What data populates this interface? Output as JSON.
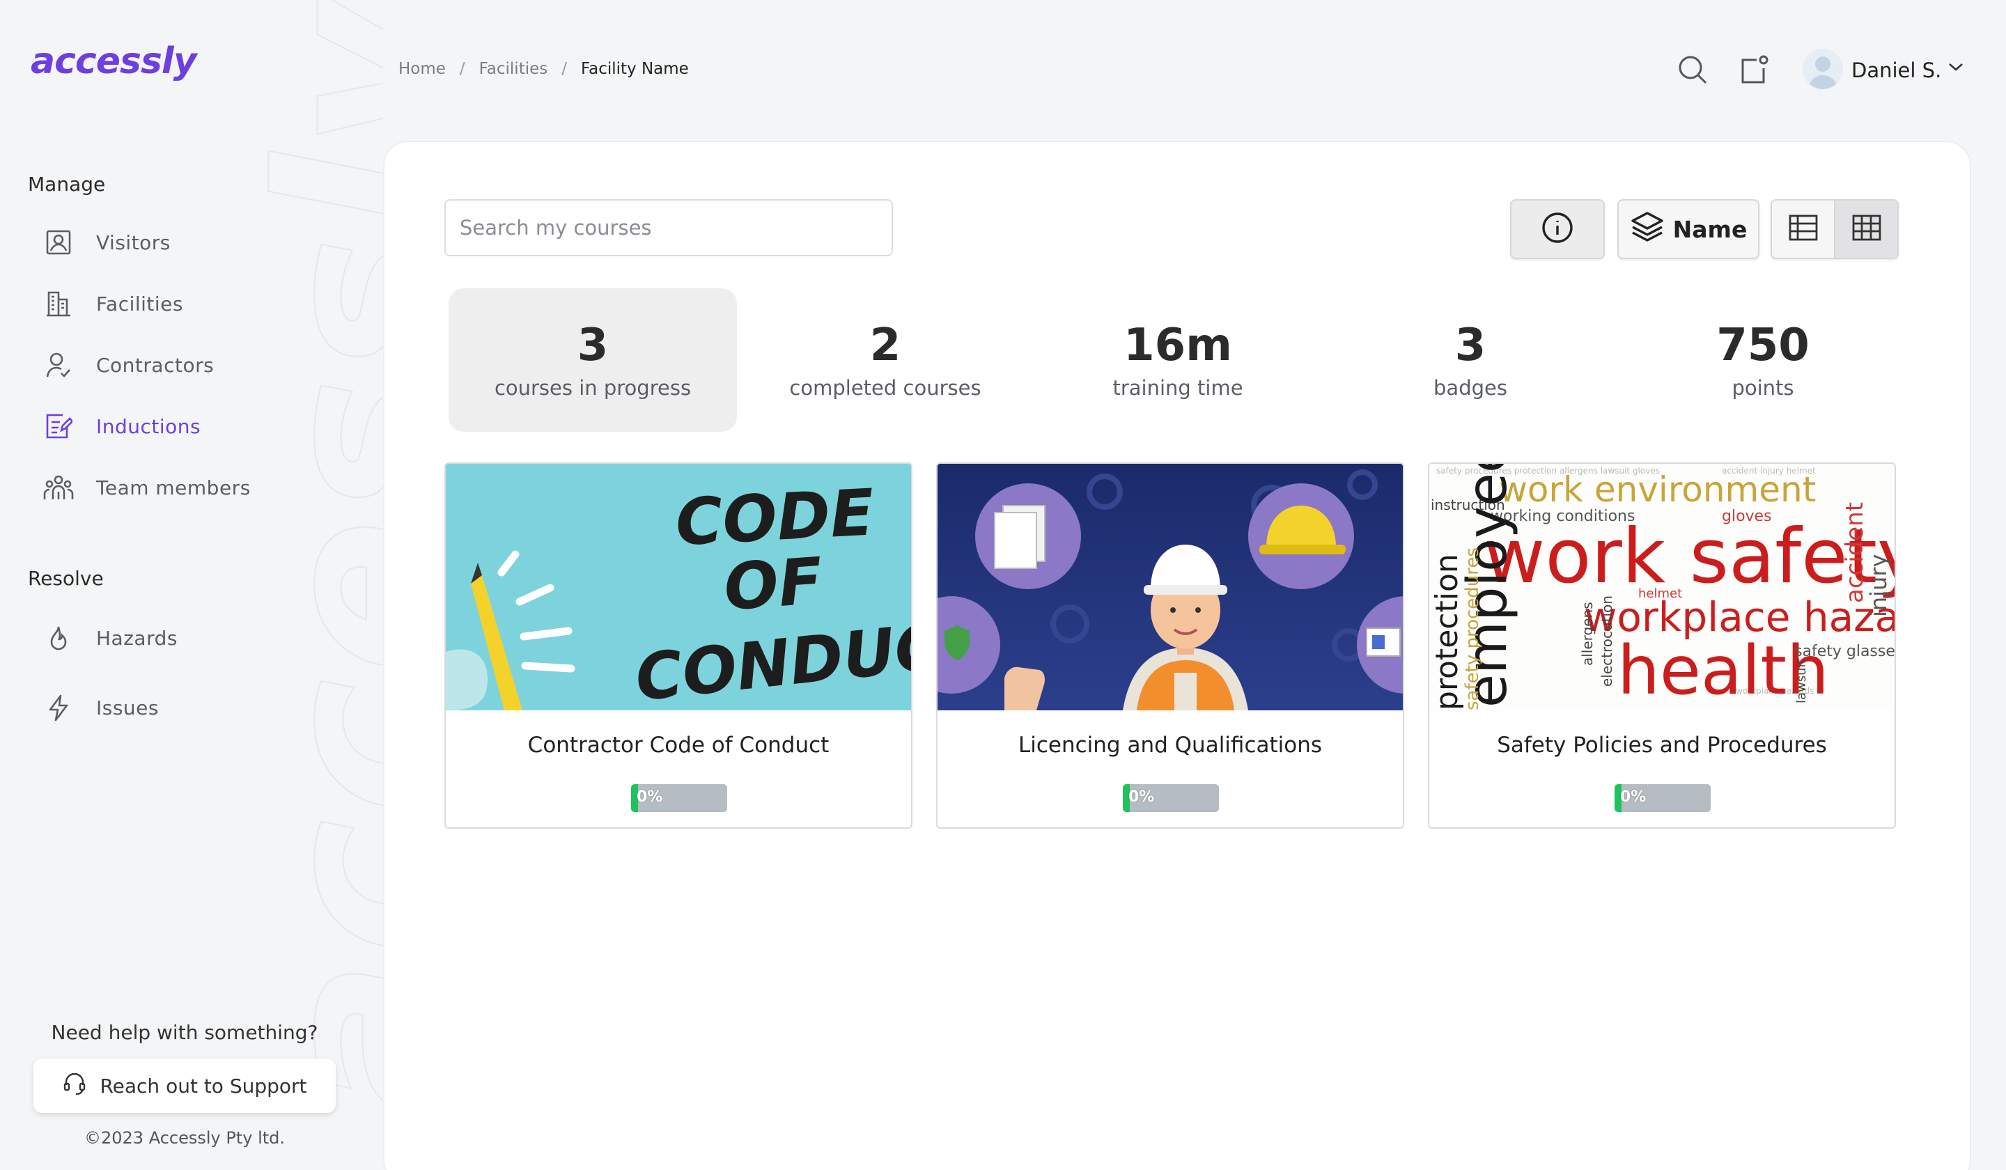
{
  "app": {
    "logo": "accessly",
    "watermark": "accessly"
  },
  "sidebar": {
    "manage_label": "Manage",
    "resolve_label": "Resolve",
    "manage_items": [
      {
        "label": "Visitors",
        "icon": "visitor-badge-icon"
      },
      {
        "label": "Facilities",
        "icon": "building-icon"
      },
      {
        "label": "Contractors",
        "icon": "user-check-icon"
      },
      {
        "label": "Inductions",
        "icon": "edit-list-icon",
        "active": true
      },
      {
        "label": "Team members",
        "icon": "team-icon"
      }
    ],
    "resolve_items": [
      {
        "label": "Hazards",
        "icon": "flame-icon"
      },
      {
        "label": "Issues",
        "icon": "lightning-icon"
      }
    ],
    "help_text": "Need help with something?",
    "support_label": "Reach out to Support",
    "copyright": "©2023 Accessly Pty ltd."
  },
  "header": {
    "breadcrumb": [
      "Home",
      "Facilities",
      "Facility Name"
    ],
    "user_name": "Daniel S."
  },
  "toolbar": {
    "search_placeholder": "Search my courses",
    "sort_label": "Name"
  },
  "stats": [
    {
      "value": "3",
      "caption": "courses in progress",
      "selected": true
    },
    {
      "value": "2",
      "caption": "completed courses"
    },
    {
      "value": "16m",
      "caption": "training time"
    },
    {
      "value": "3",
      "caption": "badges"
    },
    {
      "value": "750",
      "caption": "points"
    }
  ],
  "courses": [
    {
      "title": "Contractor Code of Conduct",
      "progress": 0,
      "progress_label": "0%",
      "thumb_text": [
        "CODE",
        "OF",
        "CONDUCT"
      ]
    },
    {
      "title": "Licencing and Qualifications",
      "progress": 0,
      "progress_label": "0%"
    },
    {
      "title": "Safety Policies and Procedures",
      "progress": 0,
      "progress_label": "0%",
      "thumb_words": [
        "work environment",
        "work safety",
        "workplace hazards",
        "health",
        "employee",
        "protection",
        "safety procedures",
        "working conditions",
        "accident",
        "injury",
        "safety glasses",
        "gloves",
        "allergens",
        "helmet",
        "lawsuit",
        "electrocution",
        "instruction"
      ]
    }
  ],
  "colors": {
    "accent": "#6c3fe0",
    "progress_fill": "#1fc35b",
    "progress_track": "#b5bcc3"
  }
}
